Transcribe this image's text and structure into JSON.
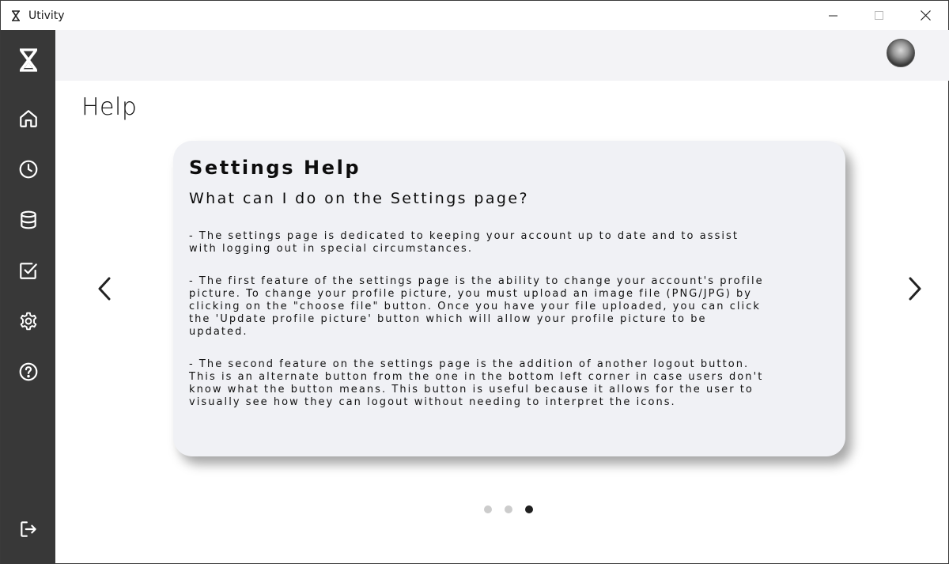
{
  "window": {
    "title": "Utivity",
    "controls": [
      "minimize",
      "maximize",
      "close"
    ]
  },
  "sidebar": {
    "logo_icon": "hourglass-logo-icon",
    "items": [
      {
        "icon": "home-icon",
        "label": "Home"
      },
      {
        "icon": "clock-icon",
        "label": "History"
      },
      {
        "icon": "database-icon",
        "label": "Data"
      },
      {
        "icon": "checkbox-icon",
        "label": "Tasks"
      },
      {
        "icon": "gear-icon",
        "label": "Settings"
      },
      {
        "icon": "help-icon",
        "label": "Help"
      }
    ],
    "logout_icon": "logout-icon"
  },
  "page": {
    "title": "Help"
  },
  "carousel": {
    "card_title": "Settings Help",
    "card_subtitle": "What can I do on the Settings page?",
    "paragraphs": [
      [
        "- The settings page is dedicated to keeping your account up to date and to assist",
        "with logging out in special circumstances."
      ],
      [
        "- The first feature of the settings page is the ability to change your account's profile",
        "picture. To change your profile picture, you must upload an image file (PNG/JPG) by",
        "clicking on the \"choose file\" button. Once you have your file uploaded, you can click",
        "the 'Update profile picture' button which will allow your profile picture to be",
        "updated."
      ],
      [
        "- The second feature on the settings page is the addition of another logout button.",
        "This is an alternate button from the one in the bottom left corner in case users don't",
        "know what the button means. This button is useful because it allows for the user to",
        "visually see how they can logout without needing to interpret the icons."
      ]
    ],
    "total_slides": 3,
    "active_slide": 3
  },
  "colors": {
    "sidebar": "#383838",
    "topbar": "#f3f3f6",
    "card": "#f0f1f5",
    "dot_inactive": "#cccccc",
    "dot_active": "#1f1f1f"
  }
}
